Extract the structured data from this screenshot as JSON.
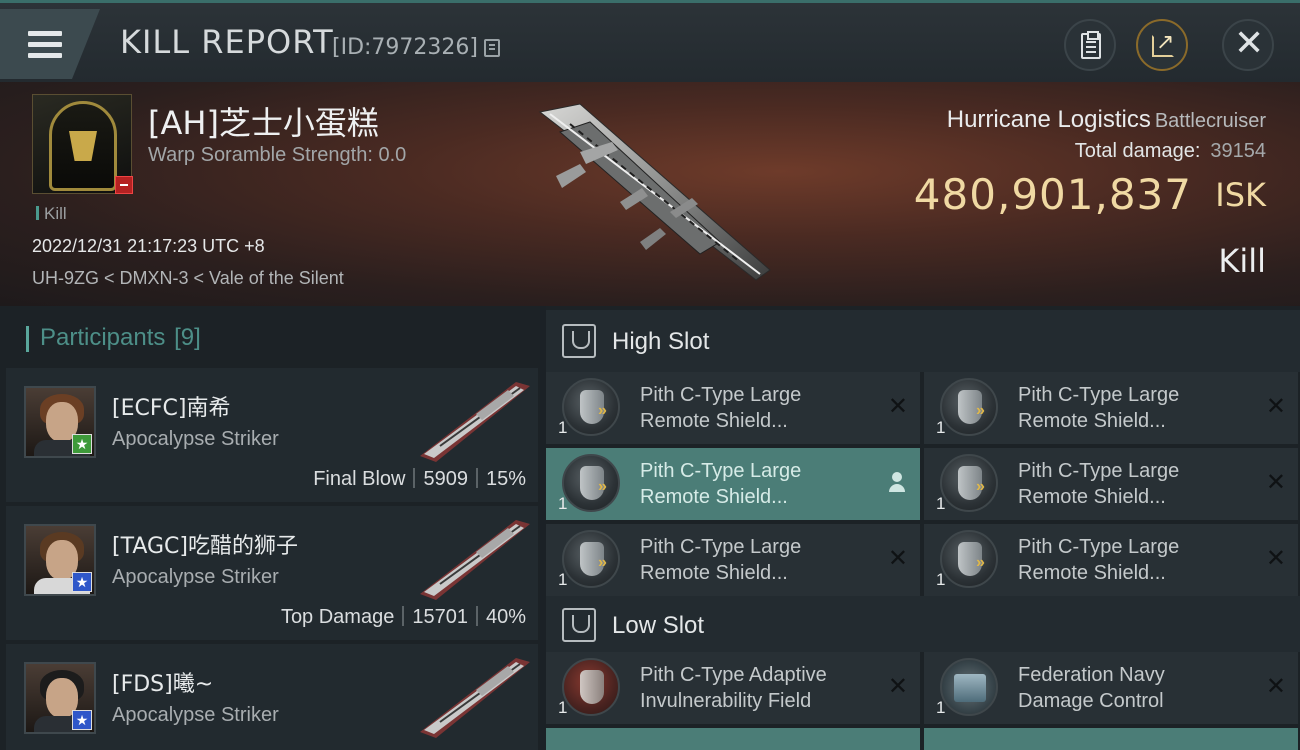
{
  "window": {
    "title": "KILL REPORT",
    "report_id": "[ID:7972326]"
  },
  "victim": {
    "name": "[AH]芝士小蛋糕",
    "warp_scramble": "Warp Soramble Strength: 0.0",
    "tag": "Kill",
    "datetime": "2022/12/31 21:17:23 UTC +8",
    "location": "UH-9ZG < DMXN-3 < Vale of the Silent",
    "ship_name": "Hurricane Logistics",
    "ship_class": "Battlecruiser",
    "total_damage_label": "Total damage:",
    "total_damage": "39154",
    "isk_value": "480,901,837",
    "isk_unit": "ISK",
    "result": "Kill"
  },
  "participants": {
    "label": "Participants",
    "count": "[9]",
    "items": [
      {
        "name": "[ECFC]南希",
        "ship": "Apocalypse Striker",
        "role": "Final Blow",
        "damage": "5909",
        "percent": "15%",
        "badge": "★",
        "badge_color": "#3e9a3a"
      },
      {
        "name": "[TAGC]吃醋的狮子",
        "ship": "Apocalypse Striker",
        "role": "Top Damage",
        "damage": "15701",
        "percent": "40%",
        "badge": "★",
        "badge_color": "#2f57c9"
      },
      {
        "name": "[FDS]曦~",
        "ship": "Apocalypse Striker",
        "badge": "★",
        "badge_color": "#2f57c9"
      }
    ]
  },
  "high_slot": {
    "title": "High Slot",
    "modules": [
      {
        "qty": "1",
        "line1": "Pith C-Type Large",
        "line2": "Remote Shield..."
      },
      {
        "qty": "1",
        "line1": "Pith C-Type Large",
        "line2": "Remote Shield..."
      },
      {
        "qty": "1",
        "line1": "Pith C-Type Large",
        "line2": "Remote Shield..."
      },
      {
        "qty": "1",
        "line1": "Pith C-Type Large",
        "line2": "Remote Shield..."
      },
      {
        "qty": "1",
        "line1": "Pith C-Type Large",
        "line2": "Remote Shield..."
      },
      {
        "qty": "1",
        "line1": "Pith C-Type Large",
        "line2": "Remote Shield..."
      }
    ]
  },
  "low_slot": {
    "title": "Low Slot",
    "modules": [
      {
        "qty": "1",
        "line1": "Pith C-Type Adaptive",
        "line2": "Invulnerability Field"
      },
      {
        "qty": "1",
        "line1": "Federation Navy",
        "line2": "Damage Control"
      }
    ]
  },
  "icons": {
    "menu": "menu-icon",
    "copy": "copy-icon",
    "clipboard": "clipboard-icon",
    "share": "share-icon",
    "close": "close-icon",
    "dropped": "x-icon",
    "pilot": "person-icon"
  },
  "colors": {
    "accent": "#4b7d77",
    "isk": "#f0d9a3",
    "participants_header": "#4d8f88"
  }
}
